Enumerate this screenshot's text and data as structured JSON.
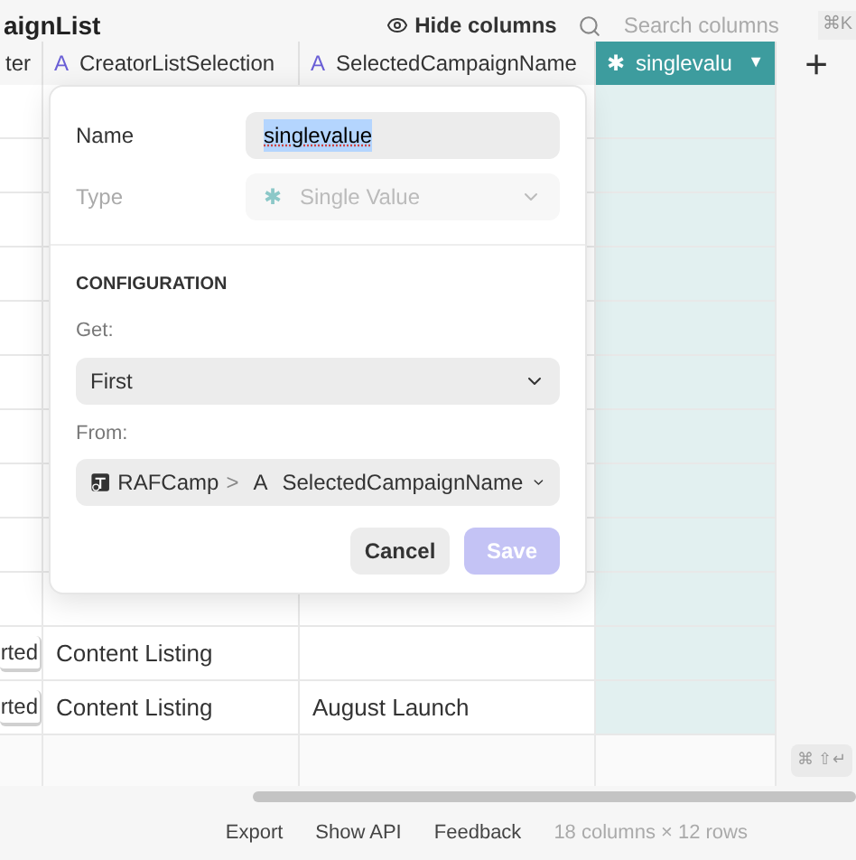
{
  "toolbar": {
    "title": "aignList",
    "hide_columns": "Hide columns",
    "search": {
      "placeholder": "Search columns",
      "shortcut": "⌘K"
    }
  },
  "columns": [
    {
      "label": "ter",
      "selected": false
    },
    {
      "label": "CreatorListSelection",
      "type_icon": "A",
      "selected": false
    },
    {
      "label": "SelectedCampaignName",
      "type_icon": "A",
      "selected": false
    },
    {
      "label": "singlevalu",
      "type_icon": "✱",
      "selected": true,
      "menu_caret": "▼"
    }
  ],
  "add_column": "+",
  "rows": [
    {
      "cells": [
        "",
        "",
        ""
      ]
    },
    {
      "cells": [
        "",
        "",
        ""
      ]
    },
    {
      "cells": [
        "",
        "",
        ""
      ]
    },
    {
      "cells": [
        "",
        "",
        ""
      ]
    },
    {
      "cells": [
        "",
        "",
        ""
      ]
    },
    {
      "cells": [
        "",
        "",
        ""
      ]
    },
    {
      "cells": [
        "",
        "",
        ""
      ]
    },
    {
      "cells": [
        "",
        "",
        ""
      ]
    },
    {
      "cells": [
        "",
        "",
        ""
      ]
    },
    {
      "cells": [
        "",
        "",
        ""
      ]
    },
    {
      "cells": [
        "rted",
        "Content Listing",
        ""
      ]
    },
    {
      "cells": [
        "rted",
        "Content Listing",
        "August Launch"
      ]
    }
  ],
  "new_row_hint": "⌘ ⇧↵",
  "dialog": {
    "name_label": "Name",
    "name_value": "singlevalue",
    "type_label": "Type",
    "type_icon": "✱",
    "type_value": "Single Value",
    "type_disabled": true,
    "section": "CONFIGURATION",
    "get_label": "Get:",
    "get_value": "First",
    "from_label": "From:",
    "from_table": "RAFCamp",
    "from_separator": ">",
    "from_column_icon": "A",
    "from_column": "SelectedCampaignName",
    "cancel": "Cancel",
    "save": "Save",
    "save_disabled": true
  },
  "footer": {
    "links": [
      "Export",
      "Show API",
      "Feedback"
    ],
    "summary": "18 columns × 12 rows"
  }
}
